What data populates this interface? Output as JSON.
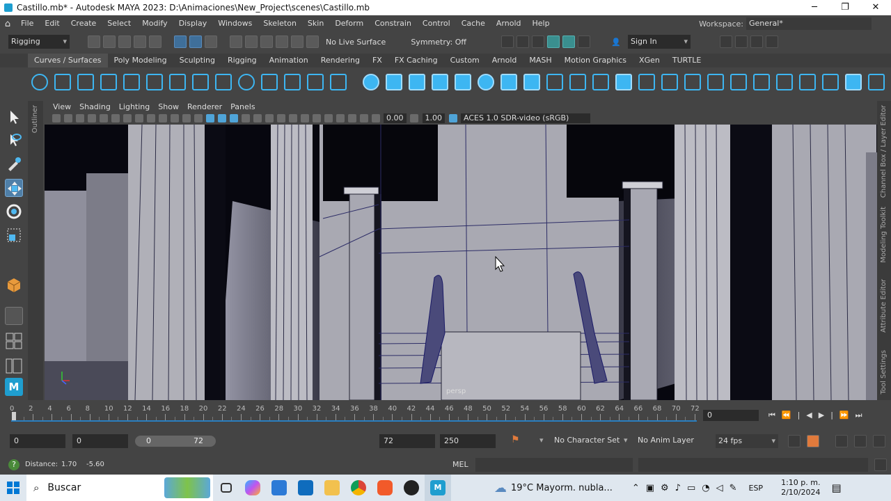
{
  "titlebar": {
    "title": "Castillo.mb* - Autodesk MAYA 2023: D:\\Animaciones\\New_Project\\scenes\\Castillo.mb",
    "minimize": "─",
    "maximize": "❐",
    "close": "✕"
  },
  "menu": [
    "File",
    "Edit",
    "Create",
    "Select",
    "Modify",
    "Display",
    "Windows",
    "Skeleton",
    "Skin",
    "Deform",
    "Constrain",
    "Control",
    "Cache",
    "Arnold",
    "Help"
  ],
  "workspace": {
    "label": "Workspace:",
    "value": "General*"
  },
  "statusline": {
    "menuset": "Rigging",
    "live_surface": "No Live Surface",
    "symmetry": "Symmetry: Off",
    "sign_in": "Sign In"
  },
  "shelf_tabs": [
    "Curves / Surfaces",
    "Poly Modeling",
    "Sculpting",
    "Rigging",
    "Animation",
    "Rendering",
    "FX",
    "FX Caching",
    "Custom",
    "Arnold",
    "MASH",
    "Motion Graphics",
    "XGen",
    "TURTLE"
  ],
  "left_panel": {
    "outliner": "Outliner"
  },
  "viewport": {
    "menu": [
      "View",
      "Shading",
      "Lighting",
      "Show",
      "Renderer",
      "Panels"
    ],
    "field_value_a": "0.00",
    "field_value_b": "1.00",
    "color_space": "ACES 1.0 SDR-video (sRGB)",
    "camera_label": "persp"
  },
  "right_tabs": [
    "Channel Box / Layer Editor",
    "Modeling Toolkit",
    "Attribute Editor",
    "Tool Settings"
  ],
  "timeline": {
    "ticks": [
      "0",
      "2",
      "4",
      "6",
      "8",
      "10",
      "12",
      "14",
      "16",
      "18",
      "20",
      "22",
      "24",
      "26",
      "28",
      "30",
      "32",
      "34",
      "36",
      "38",
      "40",
      "42",
      "44",
      "46",
      "48",
      "50",
      "52",
      "54",
      "56",
      "58",
      "60",
      "62",
      "64",
      "66",
      "68",
      "70",
      "72"
    ],
    "current_frame": "0"
  },
  "range": {
    "start": "0",
    "playback_start": "0",
    "slider_start": "0",
    "slider_end": "72",
    "playback_end": "72",
    "end": "250",
    "character_set": "No Character Set",
    "anim_layer": "No Anim Layer",
    "fps": "24 fps"
  },
  "help_line": {
    "label": "Distance:",
    "v1": "1.70",
    "v2": "-5.60",
    "mel": "MEL"
  },
  "taskbar": {
    "search": "Buscar",
    "weather": "19°C  Mayorm. nubla...",
    "language": "ESP",
    "time": "1:10 p. m.",
    "date": "2/10/2024"
  }
}
